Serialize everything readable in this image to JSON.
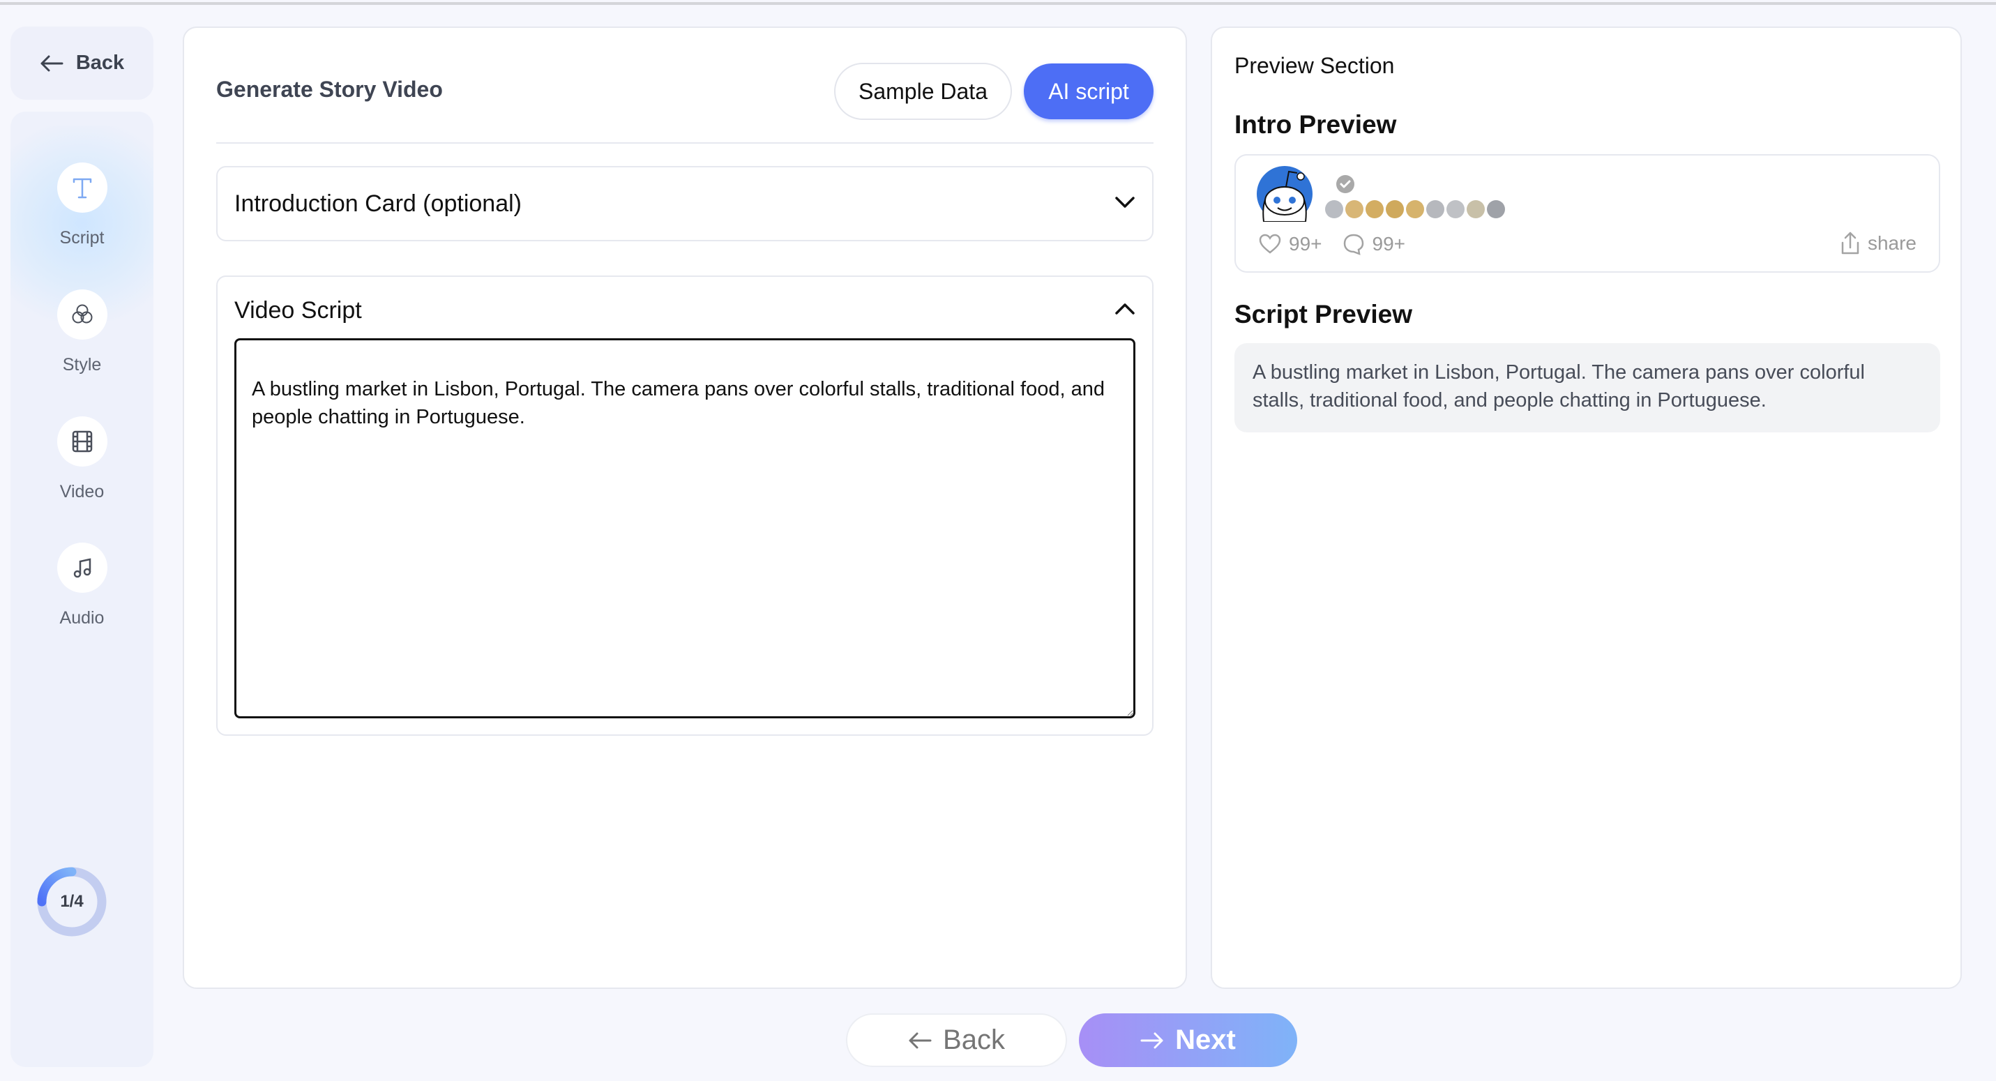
{
  "sidebar": {
    "back_label": "Back",
    "items": [
      {
        "label": "Script",
        "icon": "text-t-icon",
        "active": true
      },
      {
        "label": "Style",
        "icon": "overlapping-circles-icon",
        "active": false
      },
      {
        "label": "Video",
        "icon": "film-icon",
        "active": false
      },
      {
        "label": "Audio",
        "icon": "music-note-icon",
        "active": false
      }
    ],
    "progress": {
      "label": "1/4",
      "current": 1,
      "total": 4
    }
  },
  "main": {
    "title": "Generate Story Video",
    "sample_data_label": "Sample Data",
    "ai_script_label": "AI script",
    "intro_card": {
      "title": "Introduction Card (optional)",
      "expanded": false
    },
    "video_script": {
      "title": "Video Script",
      "expanded": true,
      "value": "A bustling market in Lisbon, Portugal. The camera pans over colorful stalls, traditional food, and people chatting in Portuguese."
    }
  },
  "preview": {
    "section_title": "Preview Section",
    "intro_title": "Intro Preview",
    "intro_card": {
      "likes": "99+",
      "comments": "99+",
      "share_label": "share",
      "badge_count": 9
    },
    "script_title": "Script Preview",
    "script_text": "A bustling market in Lisbon, Portugal. The camera pans over colorful stalls, traditional food, and people chatting in Portuguese."
  },
  "footer": {
    "back_label": "Back",
    "next_label": "Next"
  },
  "colors": {
    "accent": "#4d6ef5",
    "next_gradient_start": "#a78ff6",
    "next_gradient_end": "#7fb3f8",
    "progress_active": "#4f72f7",
    "progress_track": "#c3cdf0"
  }
}
